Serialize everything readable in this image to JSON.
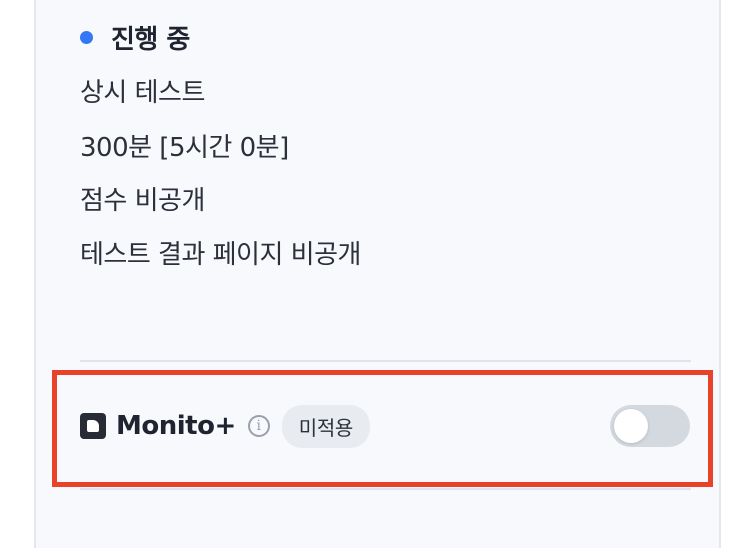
{
  "status": {
    "label": "진행 중",
    "dot_color": "#3478f6"
  },
  "details": [
    "상시 테스트",
    "300분 [5시간 0분]",
    "점수 비공개",
    "테스트 결과 페이지 비공개"
  ],
  "monito": {
    "name": "Monito+",
    "logo_icon": "monito-logo-icon",
    "info_icon": "info-icon",
    "info_glyph": "i",
    "badge": "미적용",
    "toggle_on": false
  },
  "colors": {
    "highlight_border": "#e8432a",
    "panel_bg": "#f8f9fc"
  }
}
